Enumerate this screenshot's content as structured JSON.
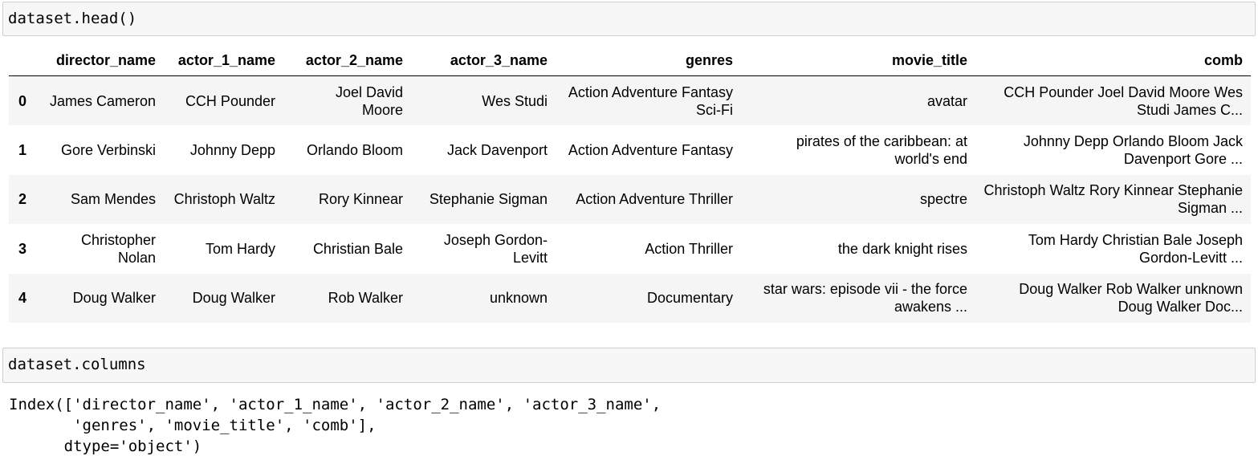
{
  "cells": [
    {
      "source": "dataset.head()"
    },
    {
      "source": "dataset.columns"
    }
  ],
  "table": {
    "columns": [
      "director_name",
      "actor_1_name",
      "actor_2_name",
      "actor_3_name",
      "genres",
      "movie_title",
      "comb"
    ],
    "rows": [
      {
        "index": "0",
        "values": [
          "James Cameron",
          "CCH Pounder",
          "Joel David Moore",
          "Wes Studi",
          "Action Adventure Fantasy Sci-Fi",
          "avatar",
          "CCH Pounder Joel David Moore Wes Studi James C..."
        ]
      },
      {
        "index": "1",
        "values": [
          "Gore Verbinski",
          "Johnny Depp",
          "Orlando Bloom",
          "Jack Davenport",
          "Action Adventure Fantasy",
          "pirates of the caribbean: at world's end",
          "Johnny Depp Orlando Bloom Jack Davenport Gore ..."
        ]
      },
      {
        "index": "2",
        "values": [
          "Sam Mendes",
          "Christoph Waltz",
          "Rory Kinnear",
          "Stephanie Sigman",
          "Action Adventure Thriller",
          "spectre",
          "Christoph Waltz Rory Kinnear Stephanie Sigman ..."
        ]
      },
      {
        "index": "3",
        "values": [
          "Christopher Nolan",
          "Tom Hardy",
          "Christian Bale",
          "Joseph Gordon-Levitt",
          "Action Thriller",
          "the dark knight rises",
          "Tom Hardy Christian Bale Joseph Gordon-Levitt ..."
        ]
      },
      {
        "index": "4",
        "values": [
          "Doug Walker",
          "Doug Walker",
          "Rob Walker",
          "unknown",
          "Documentary",
          "star wars: episode vii - the force awakens  ...",
          "Doug Walker Rob Walker unknown Doug Walker Doc..."
        ]
      }
    ]
  },
  "output": "Index(['director_name', 'actor_1_name', 'actor_2_name', 'actor_3_name',\n       'genres', 'movie_title', 'comb'],\n      dtype='object')"
}
